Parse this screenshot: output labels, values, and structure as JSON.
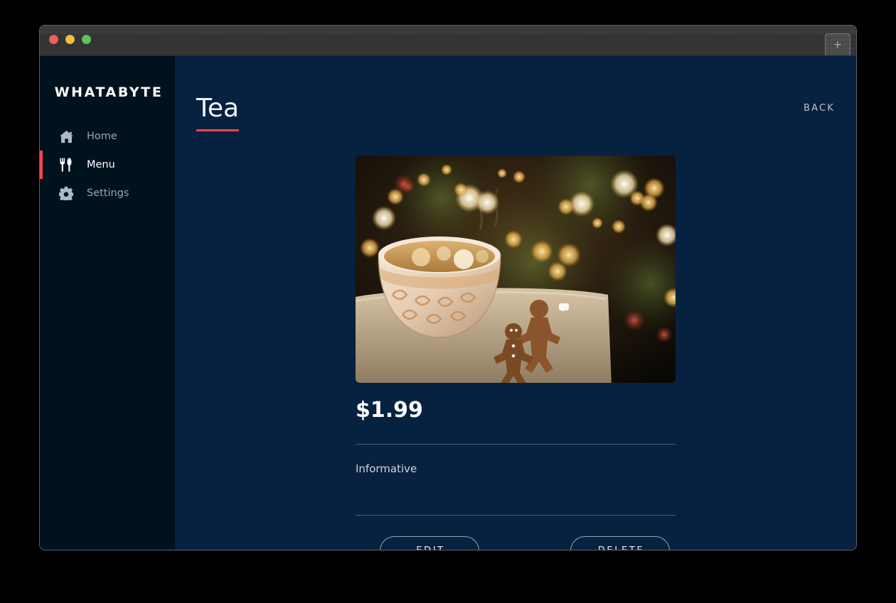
{
  "window": {
    "traffic_lights": [
      {
        "name": "close",
        "color": "#ed5f5a"
      },
      {
        "name": "minimize",
        "color": "#f3bb3f"
      },
      {
        "name": "maximize",
        "color": "#5cc45a"
      }
    ],
    "new_tab_label": "+"
  },
  "sidebar": {
    "brand": "WHATABYTE",
    "active_indicator_color": "#f0464a",
    "items": [
      {
        "label": "Home",
        "icon": "home-icon",
        "active": false
      },
      {
        "label": "Menu",
        "icon": "cutlery-icon",
        "active": true
      },
      {
        "label": "Settings",
        "icon": "gear-icon",
        "active": false
      }
    ]
  },
  "header": {
    "title": "Tea",
    "title_underline_color": "#f0464a",
    "back_label": "BACK"
  },
  "item": {
    "name": "Tea",
    "price": "$1.99",
    "description": "Informative",
    "image_alt": "cup-of-tea-with-gingerbread-cookies"
  },
  "actions": {
    "edit_label": "EDIT",
    "delete_label": "DELETE"
  },
  "colors": {
    "sidebar_bg": "#01121f",
    "main_bg": "#072140",
    "titlebar_bg": "#3b3b3b",
    "accent_red": "#f0464a",
    "text_primary": "#ffffff",
    "text_muted": "#9aa6b2"
  }
}
